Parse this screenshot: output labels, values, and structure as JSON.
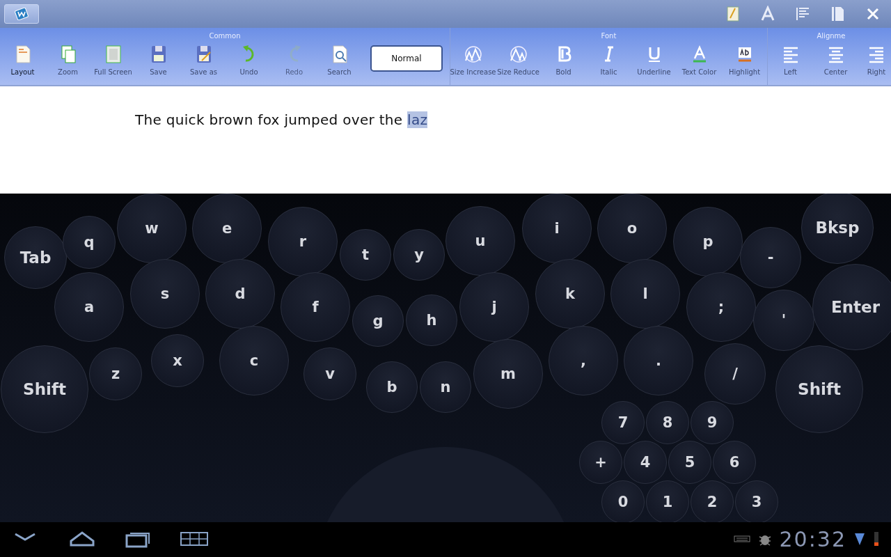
{
  "ribbon": {
    "groups": [
      {
        "title": "Common",
        "tools": [
          {
            "label": "Layout",
            "selected": true,
            "disabled": false
          },
          {
            "label": "Zoom",
            "selected": false,
            "disabled": false
          },
          {
            "label": "Full Screen",
            "selected": false,
            "disabled": false
          },
          {
            "label": "Save",
            "selected": false,
            "disabled": false
          },
          {
            "label": "Save as",
            "selected": false,
            "disabled": false
          },
          {
            "label": "Undo",
            "selected": false,
            "disabled": false
          },
          {
            "label": "Redo",
            "selected": false,
            "disabled": true
          },
          {
            "label": "Search",
            "selected": false,
            "disabled": false
          }
        ],
        "style_box": "Normal"
      },
      {
        "title": "Font",
        "tools": [
          {
            "label": "Size Increase",
            "selected": false,
            "disabled": false
          },
          {
            "label": "Size Reduce",
            "selected": false,
            "disabled": false
          },
          {
            "label": "Bold",
            "selected": false,
            "disabled": false
          },
          {
            "label": "Italic",
            "selected": false,
            "disabled": false
          },
          {
            "label": "Underline",
            "selected": false,
            "disabled": false
          },
          {
            "label": "Text Color",
            "selected": false,
            "disabled": false
          },
          {
            "label": "Highlight",
            "selected": false,
            "disabled": false
          }
        ]
      },
      {
        "title": "Alignme",
        "tools": [
          {
            "label": "Left",
            "selected": false,
            "disabled": false
          },
          {
            "label": "Center",
            "selected": false,
            "disabled": false
          },
          {
            "label": "Right",
            "selected": false,
            "disabled": false
          }
        ]
      }
    ]
  },
  "document": {
    "runs": [
      {
        "text": "The quick brown fox jumped over the ",
        "selected": false
      },
      {
        "text": "laz",
        "selected": true
      }
    ]
  },
  "keyboard": {
    "keys": [
      "Tab",
      "q",
      "w",
      "e",
      "r",
      "t",
      "y",
      "u",
      "i",
      "o",
      "p",
      "-",
      "Bksp",
      "a",
      "s",
      "d",
      "f",
      "g",
      "h",
      "j",
      "k",
      "l",
      ";",
      "'",
      "Enter",
      "Shift",
      "z",
      "x",
      "c",
      "v",
      "b",
      "n",
      "m",
      ",",
      ".",
      "/",
      "Shift",
      "7",
      "8",
      "9",
      "+",
      "4",
      "5",
      "6",
      "0",
      "1",
      "2",
      "3"
    ]
  },
  "status_bar": {
    "time": "20:32"
  }
}
